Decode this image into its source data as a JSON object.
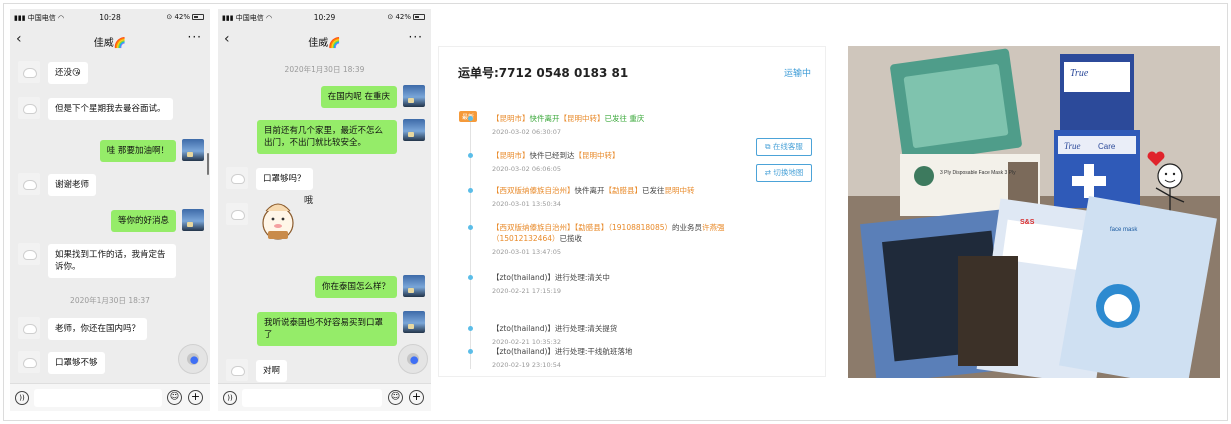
{
  "phone1": {
    "status": {
      "carrier": "中国电信",
      "time": "10:28",
      "battery": "42%"
    },
    "contact": "佳威🌈",
    "back_icon": "chevron-left-icon",
    "more_label": "···",
    "messages": [
      {
        "from": "other",
        "text": "还没😘"
      },
      {
        "from": "other",
        "text": "但是下个星期我去曼谷面试。"
      },
      {
        "from": "me",
        "text": "哇 那要加油啊！"
      },
      {
        "from": "other",
        "text": "谢谢老师"
      },
      {
        "from": "me",
        "text": "等你的好消息"
      },
      {
        "from": "other",
        "text": "如果找到工作的话，我肯定告诉你。"
      },
      {
        "from": "timestamp",
        "text": "2020年1月30日 18:37"
      },
      {
        "from": "other",
        "text": "老师，你还在国内吗？"
      },
      {
        "from": "other",
        "text": "口罩够不够"
      }
    ]
  },
  "phone2": {
    "status": {
      "carrier": "中国电信",
      "time": "10:29",
      "battery": "42%"
    },
    "contact": "佳威🌈",
    "more_label": "···",
    "messages": [
      {
        "from": "timestamp",
        "text": "2020年1月30日 18:39"
      },
      {
        "from": "me",
        "text": "在国内呢 在重庆"
      },
      {
        "from": "me",
        "text": "目前还有几个家里，最近不怎么出门，不出门就比较安全。"
      },
      {
        "from": "other",
        "text": "口罩够吗？"
      },
      {
        "from": "other",
        "text": "哦",
        "type": "sticker"
      },
      {
        "from": "me",
        "text": "你在泰国怎么样？"
      },
      {
        "from": "me",
        "text": "我听说泰国也不好容易买到口罩了"
      },
      {
        "from": "other",
        "text": "对啊"
      }
    ]
  },
  "tracking": {
    "number": "运单号:7712 0548 0183 81",
    "status": "运输中",
    "tag": "最新",
    "buttons": [
      "在线客服",
      "切换地图"
    ],
    "events": [
      {
        "parts": [
          [
            "【昆明市】",
            "orange"
          ],
          [
            "快件离开",
            "green"
          ],
          [
            "【昆明中转】",
            "orange"
          ],
          [
            "已发往 重庆",
            "green"
          ]
        ],
        "time": "2020-03-02 06:30:07"
      },
      {
        "parts": [
          [
            "【昆明市】",
            "orange"
          ],
          [
            "快件已经到达",
            ""
          ],
          [
            "【昆明中转】",
            "orange"
          ]
        ],
        "time": "2020-03-02 06:06:05"
      },
      {
        "parts": [
          [
            "【西双版纳傣族自治州】",
            "orange"
          ],
          [
            "快件离开",
            ""
          ],
          [
            "【勐腊县】",
            "orange"
          ],
          [
            "已发往",
            ""
          ],
          [
            "昆明中转",
            "orange"
          ]
        ],
        "time": "2020-03-01 13:50:34"
      },
      {
        "parts": [
          [
            "【西双版纳傣族自治州】",
            "orange"
          ],
          [
            "【勐腊县】",
            "orange"
          ],
          [
            "（19108818085）",
            "orange"
          ],
          [
            "的业务员",
            ""
          ],
          [
            "许燕强（15012132464）",
            "orange"
          ],
          [
            "已揽收",
            ""
          ]
        ],
        "time": "2020-03-01 13:47:05"
      },
      {
        "parts": [
          [
            "【zto(thailand)】进行处理:清关中",
            ""
          ]
        ],
        "time": "2020-02-21 17:15:19"
      },
      {
        "parts": [
          [
            "【zto(thailand)】进行处理:清关提货",
            ""
          ]
        ],
        "time": "2020-02-21 10:35:32"
      },
      {
        "parts": [
          [
            "【zto(thailand)】进行处理:干线航班落地",
            ""
          ]
        ],
        "time": "2020-02-19 23:10:54"
      }
    ]
  },
  "photo": {
    "box_brand_1": "True",
    "box_brand_2": "True",
    "box_brand_3": "Care",
    "mask_box_label": "3 Ply Disposable Face Mask 3 Ply",
    "packet_label": "face mask",
    "packet_brand": "S&S"
  }
}
